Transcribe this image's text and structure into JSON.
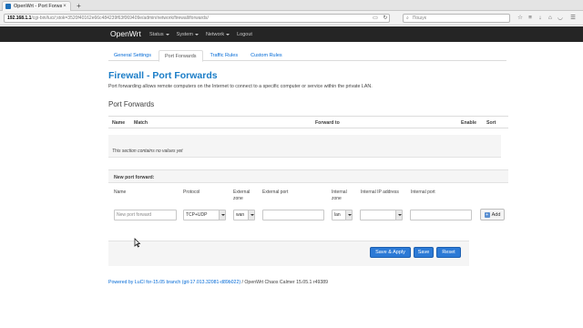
{
  "browser": {
    "tab_title": "OpenWrt - Port Forwards - LuCI",
    "new_tab_label": "+",
    "url_host": "192.168.1.1",
    "url_path": "/cgi-bin/luci/;stok=3520f40162e66c484239f63f069409e/admin/network/firewall/forwards/",
    "search_placeholder": "Пошук",
    "icons": [
      "reader-icon",
      "reload-icon",
      "search-icon",
      "bookmark-star-icon",
      "reading-list-icon",
      "downloads-icon",
      "home-icon",
      "pocket-icon"
    ]
  },
  "header": {
    "brand": "OpenWrt",
    "nav": [
      {
        "label": "Status"
      },
      {
        "label": "System"
      },
      {
        "label": "Network"
      },
      {
        "label": "Logout"
      }
    ]
  },
  "subtabs": [
    "General Settings",
    "Port Forwards",
    "Traffic Rules",
    "Custom Rules"
  ],
  "page": {
    "title": "Firewall - Port Forwards",
    "description": "Port forwarding allows remote computers on the Internet to connect to a specific computer or service within the private LAN.",
    "section_title": "Port Forwards"
  },
  "table": {
    "headers": {
      "name": "Name",
      "match": "Match",
      "forward_to": "Forward to",
      "enable": "Enable",
      "sort": "Sort"
    },
    "empty_text": "This section contains no values yet"
  },
  "new_forward": {
    "header": "New port forward:",
    "labels": {
      "name": "Name",
      "protocol": "Protocol",
      "external_zone": "External zone",
      "external_port": "External port",
      "internal_zone": "Internal zone",
      "internal_ip": "Internal IP address",
      "internal_port": "Internal port"
    },
    "values": {
      "name_placeholder": "New port forward",
      "protocol": "TCP+UDP",
      "external_zone": "wan",
      "external_port": "",
      "internal_zone": "lan",
      "internal_ip": "",
      "internal_port": ""
    },
    "add_label": "Add"
  },
  "actions": {
    "save_apply": "Save & Apply",
    "save": "Save",
    "reset": "Reset"
  },
  "footer": {
    "link": "Powered by LuCI for-15.05 branch (git-17.013.32081-d89b022)",
    "text": "/ OpenWrt Chaos Calmer 15.05.1 r49389"
  },
  "colors": {
    "header_bg": "#252525",
    "title_blue": "#1b7dc7",
    "button_blue": "#2c7ad6",
    "link_blue": "#0069d6"
  }
}
